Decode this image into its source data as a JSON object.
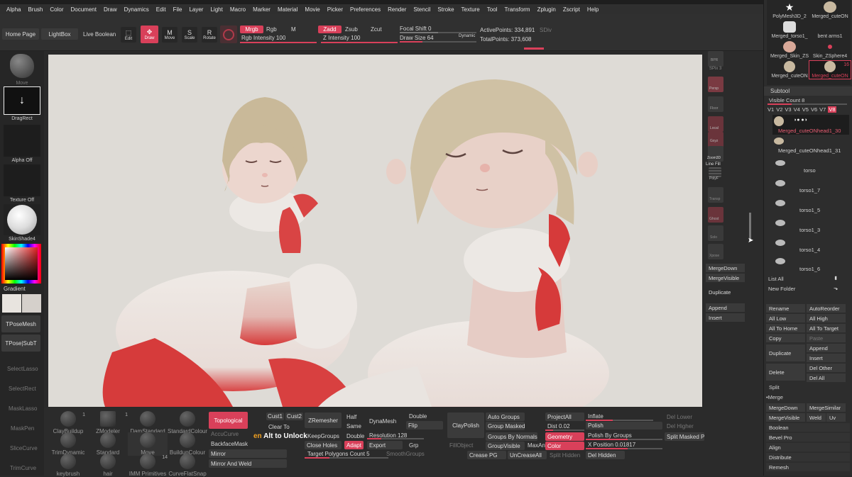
{
  "menu": [
    "Alpha",
    "Brush",
    "Color",
    "Document",
    "Draw",
    "Dynamics",
    "Edit",
    "File",
    "Layer",
    "Light",
    "Macro",
    "Marker",
    "Material",
    "Movie",
    "Picker",
    "Preferences",
    "Render",
    "Stencil",
    "Stroke",
    "Texture",
    "Tool",
    "Transform",
    "Zplugin",
    "Zscript",
    "Help"
  ],
  "top": {
    "home_page": "Home Page",
    "lightbox": "LightBox",
    "live_boolean": "Live Boolean",
    "edit": "Edit",
    "draw": "Draw",
    "move": "Move",
    "scale": "Scale",
    "rotate": "Rotate",
    "mrgb": "Mrgb",
    "rgb": "Rgb",
    "m": "M",
    "rgb_intensity": "Rgb Intensity 100",
    "zadd": "Zadd",
    "zsub": "Zsub",
    "zcut": "Zcut",
    "z_intensity": "Z Intensity 100",
    "focal_shift": "Focal Shift 0",
    "draw_size": "Draw Size 64",
    "dynamic": "Dynamic",
    "active_points": "ActivePoints: 334,891",
    "total_points": "TotalPoints: 373,608",
    "sdiv": "SDiv"
  },
  "left": {
    "move": "Move",
    "dragrect": "DragRect",
    "alpha_off": "Alpha Off",
    "texture_off": "Texture Off",
    "skinshade": "SkinShade4",
    "gradient": "Gradient",
    "tposemesh": "TPoseMesh",
    "tpose_subt": "TPose|SubT",
    "selectlasso": "SelectLasso",
    "selectrect": "SelectRect",
    "masklasso": "MaskLasso",
    "maskpen": "MaskPen",
    "slicecurve": "SliceCurve",
    "trimcurve": "TrimCurve"
  },
  "strip": {
    "bpr": "BPR",
    "spix": "SPix 3",
    "persp": "Persp",
    "floor": "Floor",
    "local": "Local",
    "gxyz": "Gxyz",
    "zoom3d": "Zoom3D",
    "line_fill": "Line Fill",
    "polyf": "PolyF",
    "transp": "Transp",
    "ghost": "Ghost",
    "solo": "Solo",
    "xpose": "Xpose",
    "merge_down": "MergeDown",
    "merge_visible": "MergeVisible",
    "duplicate": "Duplicate",
    "append": "Append",
    "insert": "Insert"
  },
  "bottom": {
    "brushes": [
      [
        "ClayBuildup",
        "1"
      ],
      [
        "ZModeler",
        "1"
      ],
      [
        "DamStandard",
        ""
      ],
      [
        "StandardColour",
        ""
      ],
      [
        "TrimDynamic",
        ""
      ],
      [
        "Standard",
        ""
      ],
      [
        "Move",
        ""
      ],
      [
        "BuildupColour",
        ""
      ],
      [
        "keybrush",
        ""
      ],
      [
        "hair",
        ""
      ],
      [
        "IMM Primitives",
        "14"
      ],
      [
        "CurveFlatSnap",
        ""
      ]
    ],
    "topological": "Topological",
    "accucurve": "AccuCurve",
    "backfacemask": "BackfaceMask",
    "mirror": "Mirror",
    "mirror_and_weld": "Mirror And Weld",
    "cust1": "Cust1",
    "cust2": "Cust2",
    "clear_to": "Clear To",
    "alt_unlock": "Alt to Unlock",
    "alt_unlock_prefix": "en",
    "zremesher": "ZRemesher",
    "keepgroups": "KeepGroups",
    "close_holes": "Close Holes",
    "target_polygons": "Target Polygons Count 5",
    "half": "Half",
    "same": "Same",
    "double": "Double",
    "adapt": "Adapt",
    "dynamesh": "DynaMesh",
    "resolution": "Resolution 128",
    "export": "Export",
    "smoothgroups": "SmoothGroups",
    "double2": "Double",
    "flip": "Flip",
    "grp": "Grp",
    "claypolish": "ClayPolish",
    "fillobject": "FillObject",
    "auto_groups": "Auto Groups",
    "group_masked": "Group Masked",
    "groups_by_normals": "Groups By Normals",
    "groupvisible": "GroupVisible",
    "maxangle": "MaxAng",
    "crease_pg": "Crease PG",
    "uncreaseall": "UnCreaseAll",
    "projectall": "ProjectAll",
    "dist": "Dist 0.02",
    "geometry": "Geometry",
    "color": "Color",
    "split_hidden": "Split Hidden",
    "inflate": "Inflate",
    "polish": "Polish",
    "polish_by_groups": "Polish By Groups",
    "x_position": "X Position 0.01817",
    "del_hidden": "Del Hidden",
    "del_lower": "Del Lower",
    "del_higher": "Del Higher",
    "split_masked": "Split Masked Po"
  },
  "right": {
    "tools": [
      [
        "PolyMesh3D_2",
        ""
      ],
      [
        "Merged_cuteON",
        ""
      ],
      [
        "Merged_torso1_",
        ""
      ],
      [
        "bent arms1",
        ""
      ],
      [
        "Merged_Skin_ZS",
        ""
      ],
      [
        "Skin_ZSphere4",
        ""
      ],
      [
        "Merged_cuteON",
        ""
      ],
      [
        "Merged_cuteON",
        "16"
      ]
    ],
    "subtool": "Subtool",
    "visible_count": "Visible Count 8",
    "versions": [
      "V1",
      "V2",
      "V3",
      "V4",
      "V5",
      "V6",
      "V7",
      "V8"
    ],
    "subtools": [
      "Merged_cuteONhead1_30",
      "Merged_cuteONhead1_31",
      "torso",
      "torso1_7",
      "torso1_5",
      "torso1_3",
      "torso1_4",
      "torso1_6"
    ],
    "list_all": "List All",
    "new_folder": "New Folder",
    "rename": "Rename",
    "autoreorder": "AutoReorder",
    "all_low": "All Low",
    "all_high": "All High",
    "all_to_home": "All To Home",
    "all_to_target": "All To Target",
    "copy": "Copy",
    "paste": "Paste",
    "duplicate": "Duplicate",
    "append": "Append",
    "insert": "Insert",
    "delete": "Delete",
    "del_other": "Del Other",
    "del_all": "Del All",
    "split": "Split",
    "merge": "Merge",
    "mergedown": "MergeDown",
    "mergesimilar": "MergeSimilar",
    "mergevisible": "MergeVisible",
    "weld": "Weld",
    "uv": "Uv",
    "boolean": "Boolean",
    "bevel_pro": "Bevel Pro",
    "align": "Align",
    "distribute": "Distribute",
    "remesh": "Remesh"
  },
  "colors": {
    "accent": "#d9405a",
    "viewport": "#dedbd6"
  }
}
